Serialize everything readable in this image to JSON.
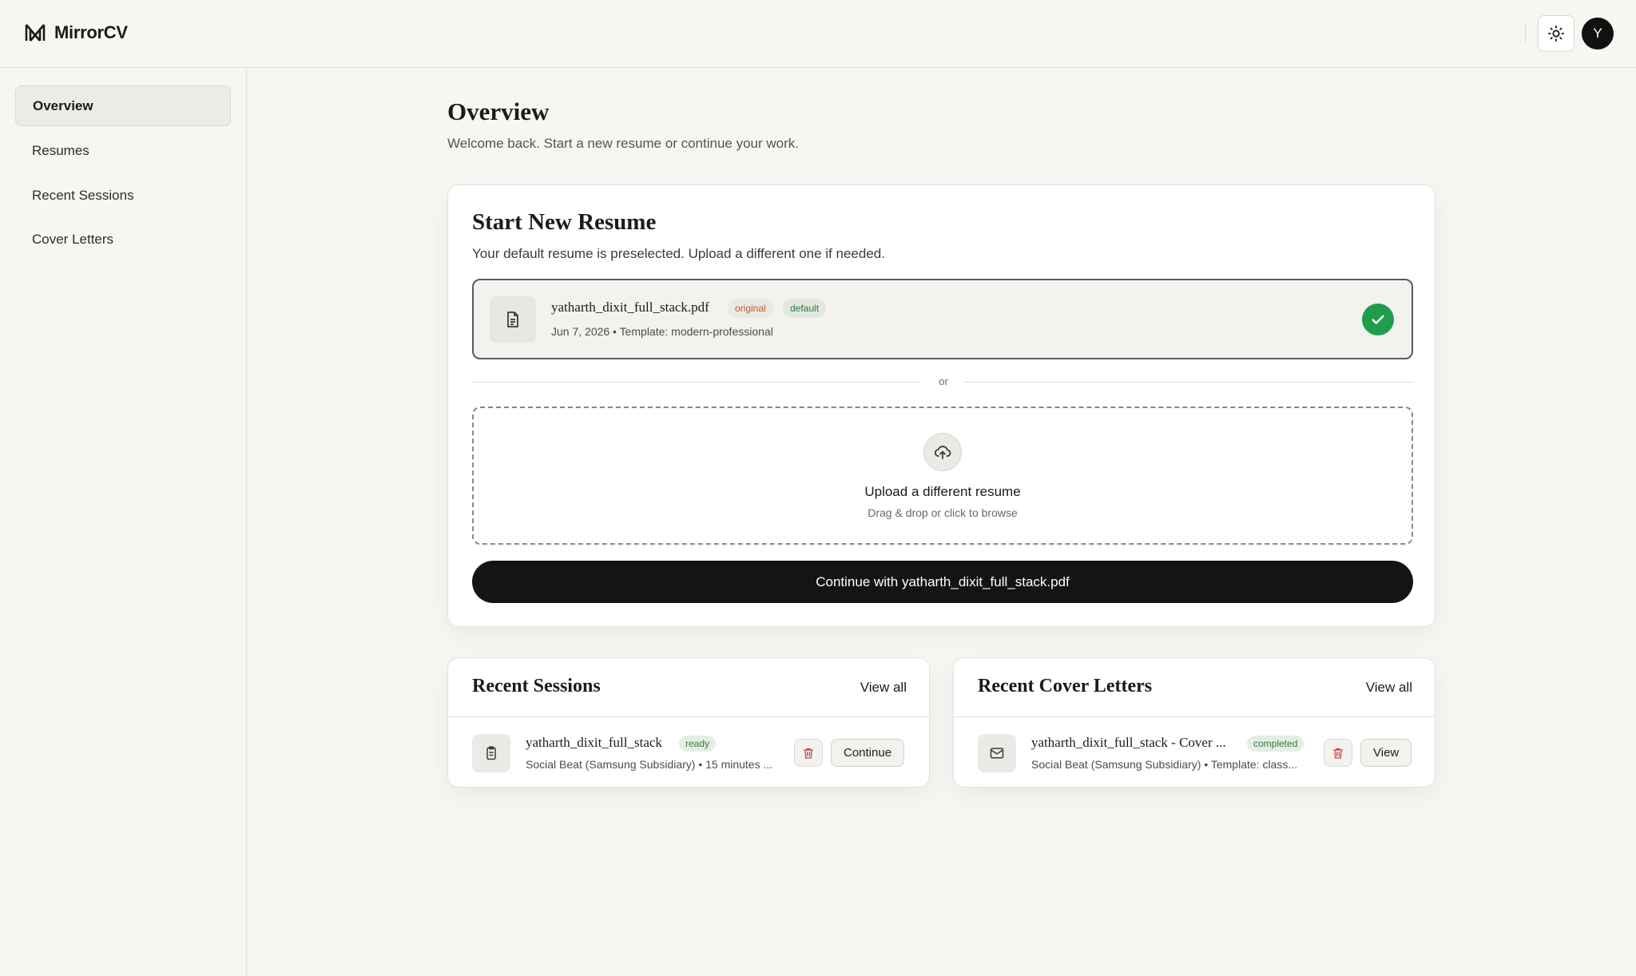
{
  "app": {
    "name": "MirrorCV",
    "logo_icon": "mirror-logo-icon"
  },
  "header": {
    "theme_icon": "sun-icon",
    "avatar_initial": "Y"
  },
  "sidebar": {
    "items": [
      {
        "label": "Overview",
        "active": true
      },
      {
        "label": "Resumes",
        "active": false
      },
      {
        "label": "Recent Sessions",
        "active": false
      },
      {
        "label": "Cover Letters",
        "active": false
      }
    ]
  },
  "page": {
    "title": "Overview",
    "subtitle": "Welcome back. Start a new resume or continue your work."
  },
  "new_resume": {
    "title": "Start New Resume",
    "subtitle": "Your default resume is preselected. Upload a different one if needed.",
    "file": {
      "name": "yatharth_dixit_full_stack.pdf",
      "badge_original": "original",
      "badge_default": "default",
      "meta": "Jun 7, 2026 • Template: modern-professional",
      "selected": true
    },
    "divider_text": "or",
    "upload": {
      "title": "Upload a different resume",
      "subtitle": "Drag & drop or click to browse"
    },
    "continue_label": "Continue with yatharth_dixit_full_stack.pdf"
  },
  "recent_sessions": {
    "title": "Recent Sessions",
    "view_all": "View all",
    "item": {
      "title": "yatharth_dixit_full_stack",
      "badge": "ready",
      "meta": "Social Beat (Samsung Subsidiary) • 15 minutes ...",
      "action": "Continue"
    }
  },
  "recent_cover_letters": {
    "title": "Recent Cover Letters",
    "view_all": "View all",
    "item": {
      "title": "yatharth_dixit_full_stack - Cover ...",
      "badge": "completed",
      "meta": "Social Beat (Samsung Subsidiary) • Template: class...",
      "action": "View"
    }
  },
  "colors": {
    "background": "#f7f6f3",
    "primary_button": "#141412",
    "success": "#1f9d4c",
    "badge_original_text": "#c05a2a",
    "badge_green_text": "#2c7a3f",
    "danger_icon": "#d14343"
  }
}
